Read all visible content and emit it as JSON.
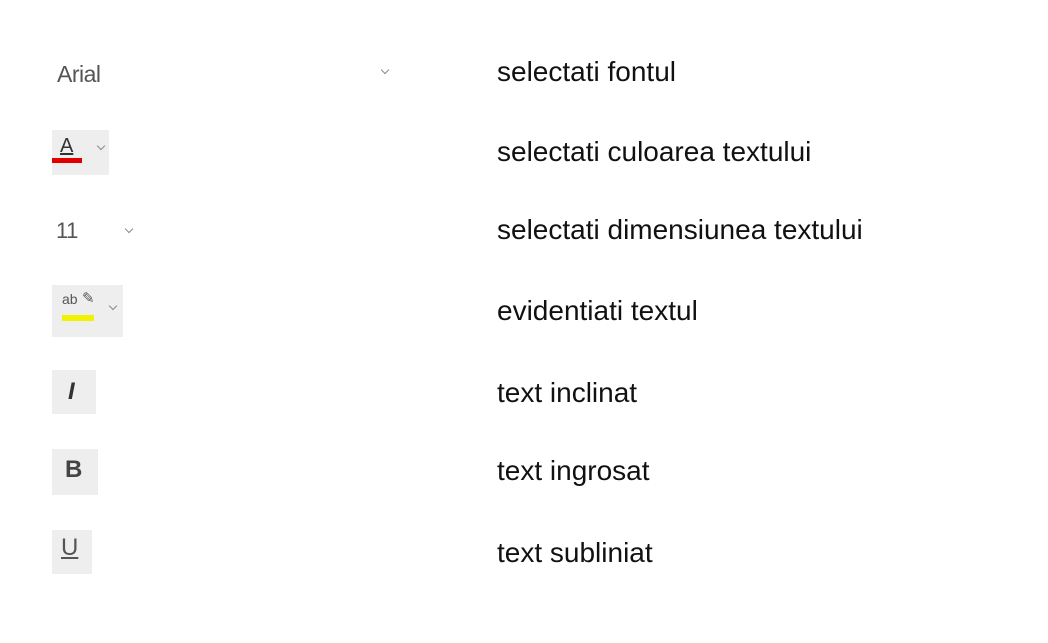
{
  "rows": [
    {
      "control_value": "Arial",
      "description": "selectati fontul"
    },
    {
      "control_value": "A",
      "description": "selectati culoarea textului",
      "accent": "#e00000"
    },
    {
      "control_value": "11",
      "description": "selectati dimensiunea textului"
    },
    {
      "control_value": "ab",
      "description": "evidentiati textul",
      "accent": "#f2f200"
    },
    {
      "control_value": "I",
      "description": "text inclinat"
    },
    {
      "control_value": "B",
      "description": "text ingrosat"
    },
    {
      "control_value": "U",
      "description": "text subliniat"
    }
  ],
  "icons": {
    "font_dropdown": "chevron-down-icon",
    "text_color": "font-color-icon",
    "size_dropdown": "chevron-down-icon",
    "highlight": "highlighter-icon",
    "italic": "italic-icon",
    "bold": "bold-icon",
    "underline": "underline-icon"
  }
}
